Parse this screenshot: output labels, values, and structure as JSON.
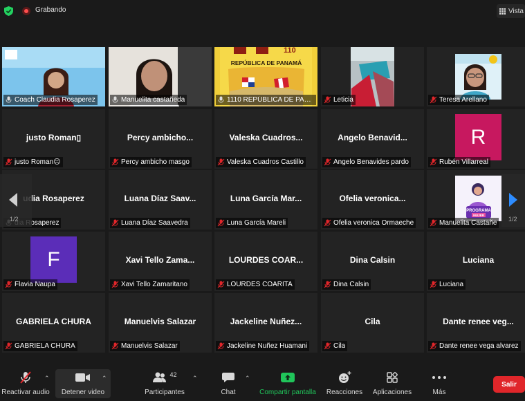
{
  "header": {
    "recording_label": "Grabando",
    "view_label": "Vista",
    "colors": {
      "security": "#23d160",
      "recording": "#ff4d4d"
    }
  },
  "pagination": {
    "left": "1/2",
    "right": "1/2"
  },
  "tiles": [
    {
      "kind": "video",
      "center": "",
      "label": "Coach Claudia Rosaperez",
      "muted": false
    },
    {
      "kind": "video",
      "center": "",
      "label": "Manuelita castañeda",
      "muted": false
    },
    {
      "kind": "video",
      "center": "",
      "label": "1110 REPÚBLICA DE PANA...",
      "muted": false,
      "image_text": [
        "110",
        "REPÚBLICA DE PANAMÁ"
      ]
    },
    {
      "kind": "video",
      "center": "",
      "label": "Leticia",
      "muted": true
    },
    {
      "kind": "video",
      "center": "",
      "label": "Teresa Arellano",
      "muted": true
    },
    {
      "kind": "name",
      "center": "justo  Roman▯",
      "label": "justo  Roman☹",
      "muted": true
    },
    {
      "kind": "name",
      "center": "Percy  ambicho...",
      "label": "Percy ambicho masgo",
      "muted": true
    },
    {
      "kind": "name",
      "center": "Valeska  Cuadros...",
      "label": "Valeska Cuadros Castillo",
      "muted": true
    },
    {
      "kind": "name",
      "center": "Angelo  Benavid...",
      "label": "Angelo Benavides pardo",
      "muted": true
    },
    {
      "kind": "avatar",
      "initial": "R",
      "avatar_color": "#c7185f",
      "label": "Rubén Villarreal",
      "muted": true
    },
    {
      "kind": "name",
      "center": "udia Rosaperez",
      "label": "dia Rosaperez",
      "muted": false
    },
    {
      "kind": "name",
      "center": "Luana  Díaz  Saav...",
      "label": "Luana Díaz Saavedra",
      "muted": true
    },
    {
      "kind": "name",
      "center": "Luna  García  Mar...",
      "label": "Luna García Mareli",
      "muted": true
    },
    {
      "kind": "name",
      "center": "Ofelia  veronica...",
      "label": "Ofelia veronica Ormaeche",
      "muted": true
    },
    {
      "kind": "picture",
      "label": "Manuelita Castañe",
      "muted": true,
      "image_text": [
        "PROGRAMA",
        "MUJER"
      ]
    },
    {
      "kind": "avatar",
      "initial": "F",
      "avatar_color": "#5b2db8",
      "label": "Flavia Ñaupa",
      "muted": true
    },
    {
      "kind": "name",
      "center": "Xavi  Tello  Zama...",
      "label": "Xavi Tello Zamaritano",
      "muted": true
    },
    {
      "kind": "name",
      "center": "LOURDES  COAR...",
      "label": "LOURDES COARITA",
      "muted": true
    },
    {
      "kind": "name",
      "center": "Dina Calsin",
      "label": "Dina Calsin",
      "muted": true
    },
    {
      "kind": "name",
      "center": "Luciana",
      "label": "Luciana",
      "muted": true
    },
    {
      "kind": "name",
      "center": "GABRIELA CHURA",
      "label": "GABRIELA CHURA",
      "muted": true
    },
    {
      "kind": "name",
      "center": "Manuelvis Salazar",
      "label": "Manuelvis Salazar",
      "muted": true
    },
    {
      "kind": "name",
      "center": "Jackeline  Nuñez...",
      "label": "Jackeline Nuñez Huamani",
      "muted": true
    },
    {
      "kind": "name",
      "center": "Cila",
      "label": "Cila",
      "muted": true
    },
    {
      "kind": "name",
      "center": "Dante  renee  veg...",
      "label": "Dante renee vega alvarez",
      "muted": true
    }
  ],
  "toolbar": {
    "unmute_label": "Reactivar audio",
    "stop_video_label": "Detener video",
    "participants_label": "Participantes",
    "participants_count": "42",
    "chat_label": "Chat",
    "share_label": "Compartir pantalla",
    "reactions_label": "Reacciones",
    "apps_label": "Aplicaciones",
    "more_label": "Más",
    "leave_label": "Salir",
    "colors": {
      "share": "#20c55a",
      "leave": "#e0262a",
      "muted_mic": "#e0262a"
    }
  }
}
